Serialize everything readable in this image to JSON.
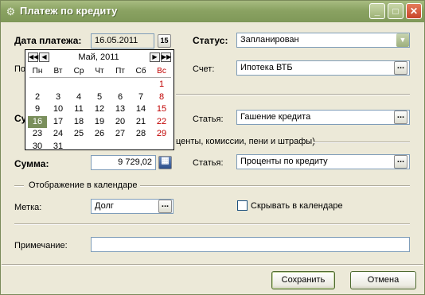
{
  "window": {
    "title": "Платеж по кредиту",
    "icon": "gear-icon",
    "controls": [
      "_",
      "□",
      "✕"
    ]
  },
  "form": {
    "date_label": "Дата платежа:",
    "date_value": "16.05.2011",
    "date_btn": "15",
    "po_label": "По",
    "status_label": "Статус:",
    "status_value": "Запланирован",
    "account_label": "Счет:",
    "account_value": "Ипотека ВТБ",
    "su_label": "Су",
    "article1_label": "Статья:",
    "article1_value": "Гашение кредита",
    "group2_title": "центы, комиссии, пени и штрафы)",
    "sum_label": "Сумма:",
    "sum_value": "9 729,02",
    "article2_label": "Статья:",
    "article2_value": "Проценты по кредиту",
    "calendar_group": "Отображение в календаре",
    "mark_label": "Метка:",
    "mark_value": "Долг",
    "hide_label": "Скрывать в календаре",
    "note_label": "Примечание:",
    "note_value": "",
    "dots": "...",
    "combo_arrow": "▼"
  },
  "calendar": {
    "month": "Май, 2011",
    "nav": {
      "first": "◀◀",
      "prev": "◀",
      "next": "▶",
      "last": "▶▶"
    },
    "weekdays": [
      "Пн",
      "Вт",
      "Ср",
      "Чт",
      "Пт",
      "Сб",
      "Вс"
    ],
    "weeks": [
      [
        "",
        "",
        "",
        "",
        "",
        "",
        "1"
      ],
      [
        "2",
        "3",
        "4",
        "5",
        "6",
        "7",
        "8"
      ],
      [
        "9",
        "10",
        "11",
        "12",
        "13",
        "14",
        "15"
      ],
      [
        "16",
        "17",
        "18",
        "19",
        "20",
        "21",
        "22"
      ],
      [
        "23",
        "24",
        "25",
        "26",
        "27",
        "28",
        "29"
      ],
      [
        "30",
        "31",
        "",
        "",
        "",
        "",
        ""
      ]
    ],
    "selected": "16",
    "weekend_color": "#c00000"
  },
  "buttons": {
    "save": "Сохранить",
    "cancel": "Отмена"
  },
  "colors": {
    "titlebar": "#8aa262",
    "selected_day": "#7a8f5c"
  }
}
